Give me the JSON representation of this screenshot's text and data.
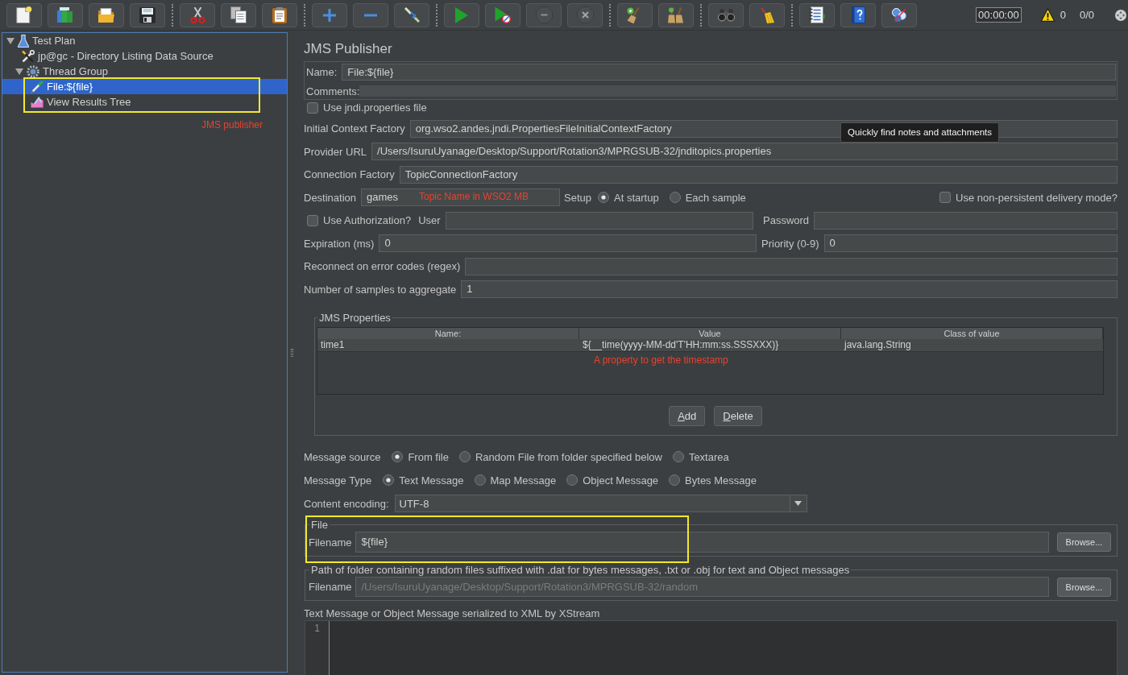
{
  "toolbar": {
    "groups": [
      [
        {
          "kind": "new",
          "disabled": false
        },
        {
          "kind": "templates",
          "disabled": false
        },
        {
          "kind": "open",
          "disabled": false
        },
        {
          "kind": "save",
          "disabled": false
        }
      ],
      [
        {
          "kind": "cut",
          "disabled": false
        },
        {
          "kind": "copy",
          "disabled": false
        },
        {
          "kind": "paste",
          "disabled": false
        }
      ],
      [
        {
          "kind": "expand",
          "disabled": false
        },
        {
          "kind": "collapse",
          "disabled": false
        },
        {
          "kind": "toggle",
          "disabled": false
        }
      ],
      [
        {
          "kind": "start",
          "disabled": false
        },
        {
          "kind": "nopause",
          "disabled": false
        },
        {
          "kind": "stop",
          "disabled": true
        },
        {
          "kind": "shutdown",
          "disabled": true
        }
      ],
      [
        {
          "kind": "clear",
          "disabled": false
        },
        {
          "kind": "clearall",
          "disabled": false
        }
      ],
      [
        {
          "kind": "search",
          "disabled": false
        },
        {
          "kind": "reset",
          "disabled": false
        }
      ],
      [
        {
          "kind": "functions",
          "disabled": false
        },
        {
          "kind": "help",
          "disabled": false
        },
        {
          "kind": "remote",
          "disabled": false
        }
      ]
    ],
    "timer": "00:00:00",
    "warnings": "0",
    "threads": "0/0"
  },
  "navigator": {
    "items": [
      {
        "label": "Test Plan",
        "kind": "plan",
        "expanded": true,
        "selected": false,
        "children": [
          {
            "label": "jp@gc - Directory Listing Data Source",
            "kind": "config",
            "selected": false
          },
          {
            "label": "Thread Group",
            "kind": "threads",
            "expanded": true,
            "selected": false,
            "children": [
              {
                "label": "File:${file}",
                "kind": "sampler",
                "selected": true
              },
              {
                "label": "View Results Tree",
                "kind": "listener",
                "selected": false
              }
            ]
          }
        ]
      }
    ],
    "note": "JMS publisher"
  },
  "tooltip": "Quickly find notes and attachments",
  "editor": {
    "title": "JMS Publisher",
    "name": {
      "label": "Name:",
      "value": "File:${file}"
    },
    "comments": {
      "label": "Comments:"
    },
    "use_jndi": {
      "label": "Use jndi.properties file",
      "checked": false
    },
    "initial_context_factory": {
      "label": "Initial Context Factory",
      "value": "org.wso2.andes.jndi.PropertiesFileInitialContextFactory"
    },
    "provider_url": {
      "label": "Provider URL",
      "value": "/Users/IsuruUyanage/Desktop/Support/Rotation3/MPRGSUB-32/jnditopics.properties"
    },
    "connection_factory": {
      "label": "Connection Factory",
      "value": "TopicConnectionFactory"
    },
    "destination": {
      "label": "Destination",
      "value": "games",
      "note": "Topic Name in WSO2 MB"
    },
    "setup": {
      "label": "Setup",
      "options": [
        {
          "label": "At startup",
          "selected": true
        },
        {
          "label": "Each sample",
          "selected": false
        }
      ]
    },
    "non_persistent": {
      "label": "Use non-persistent delivery mode?",
      "checked": false
    },
    "authorization": {
      "label": "Use Authorization?",
      "checked": false
    },
    "user": {
      "label": "User"
    },
    "password": {
      "label": "Password"
    },
    "expiration": {
      "label": "Expiration (ms)",
      "value": "0"
    },
    "priority": {
      "label": "Priority (0-9)",
      "value": "0"
    },
    "reconnect": {
      "label": "Reconnect on error codes (regex)"
    },
    "aggregate": {
      "label": "Number of samples to aggregate",
      "value": "1"
    },
    "jms_properties": {
      "title": "JMS Properties",
      "columns": [
        "Name:",
        "Value",
        "Class of value"
      ],
      "rows": [
        [
          "time1",
          "${__time(yyyy-MM-dd'T'HH:mm:ss.SSSXXX)}",
          "java.lang.String"
        ]
      ],
      "note": "A property to get the timestamp",
      "buttons": [
        "Add",
        "Delete"
      ]
    },
    "message_source": {
      "label": "Message source",
      "options": [
        {
          "label": "From file",
          "selected": true
        },
        {
          "label": "Random File from folder specified below",
          "selected": false
        },
        {
          "label": "Textarea",
          "selected": false
        }
      ]
    },
    "message_type": {
      "label": "Message Type",
      "options": [
        {
          "label": "Text Message",
          "selected": true
        },
        {
          "label": "Map Message",
          "selected": false
        },
        {
          "label": "Object Message",
          "selected": false
        },
        {
          "label": "Bytes Message",
          "selected": false
        }
      ]
    },
    "content_encoding": {
      "label": "Content encoding:",
      "value": "UTF-8"
    },
    "file": {
      "title": "File",
      "label": "Filename",
      "value": "${file}",
      "button": "Browse...",
      "disabled": false
    },
    "folder": {
      "title": "Path of folder containing random files suffixed with .dat for bytes messages, .txt or .obj for text and Object messages",
      "label": "Filename",
      "value": "/Users/IsuruUyanage/Desktop/Support/Rotation3/MPRGSUB-32/random",
      "button": "Browse...",
      "disabled": true
    },
    "text_message": {
      "label": "Text Message or Object Message serialized to XML by XStream",
      "lines": [
        "1"
      ]
    }
  }
}
